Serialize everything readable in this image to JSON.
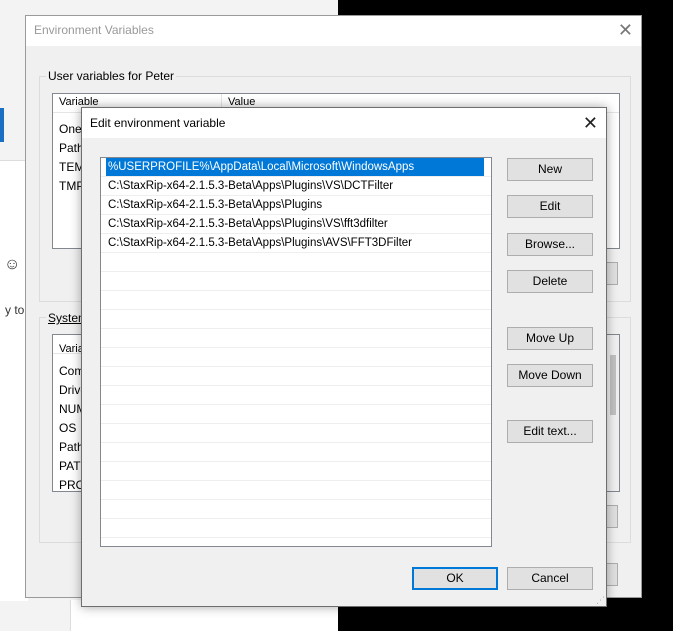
{
  "background": {
    "fragment_text": "y to f",
    "smiley_icon": "smiley-icon"
  },
  "env_dialog": {
    "title": "Environment Variables",
    "user_group": {
      "label": "User variables for Peter",
      "col_variable": "Variable",
      "col_value": "Value",
      "rows": [
        "One",
        "Path",
        "TEM",
        "TMP"
      ]
    },
    "system_group": {
      "label": "System",
      "col_variable": "Varia",
      "rows": [
        "Com",
        "Drive",
        "NUM",
        "OS",
        "Path",
        "PATH",
        "PRO"
      ]
    }
  },
  "edit_dialog": {
    "title": "Edit environment variable",
    "paths": [
      "%USERPROFILE%\\AppData\\Local\\Microsoft\\WindowsApps",
      "C:\\StaxRip-x64-2.1.5.3-Beta\\Apps\\Plugins\\VS\\DCTFilter",
      "C:\\StaxRip-x64-2.1.5.3-Beta\\Apps\\Plugins",
      "C:\\StaxRip-x64-2.1.5.3-Beta\\Apps\\Plugins\\VS\\fft3dfilter",
      "C:\\StaxRip-x64-2.1.5.3-Beta\\Apps\\Plugins\\AVS\\FFT3DFilter"
    ],
    "selected_index": 0,
    "buttons": {
      "new": "New",
      "edit": "Edit",
      "browse": "Browse...",
      "delete": "Delete",
      "move_up": "Move Up",
      "move_down": "Move Down",
      "edit_text": "Edit text...",
      "ok": "OK",
      "cancel": "Cancel"
    }
  }
}
